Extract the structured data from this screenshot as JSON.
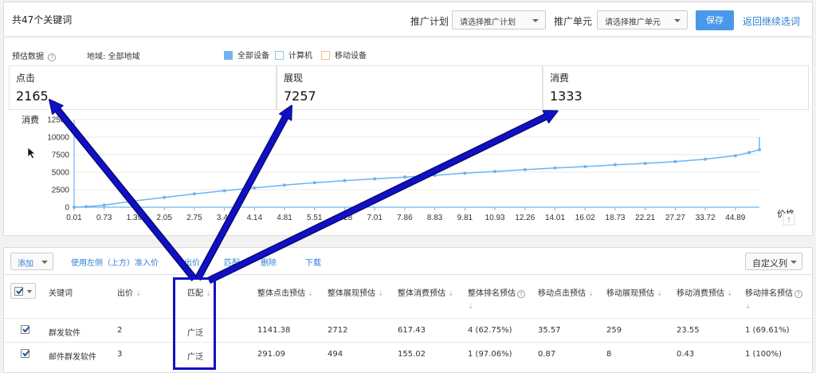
{
  "header": {
    "title": "共47个关键词",
    "plan_label": "推广计划",
    "plan_select": "请选择推广计划",
    "unit_label": "推广单元",
    "unit_select": "请选择推广单元",
    "save": "保存",
    "back": "返回继续选词"
  },
  "estimate": {
    "label": "预估数据",
    "region": "地域: 全部地域",
    "legend": [
      {
        "name": "全部设备",
        "color": "#6fb3f0",
        "filled": true
      },
      {
        "name": "计算机",
        "color": "#8fc5ea",
        "filled": false
      },
      {
        "name": "移动设备",
        "color": "#f0c080",
        "filled": false
      }
    ]
  },
  "stats": [
    {
      "name": "点击",
      "value": "2165"
    },
    {
      "name": "展现",
      "value": "7257"
    },
    {
      "name": "消费",
      "value": "1333"
    }
  ],
  "chart_data": {
    "type": "line",
    "ylabel": "消费",
    "xlabel": "价格",
    "ylim": [
      0,
      12500
    ],
    "yticks": [
      "0",
      "2500",
      "5000",
      "7500",
      "10000",
      "12500"
    ],
    "x": [
      "0.01",
      "0.73",
      "1.39",
      "2.05",
      "2.75",
      "3.44",
      "4.14",
      "4.81",
      "5.51",
      "6.28",
      "7.01",
      "7.86",
      "8.83",
      "9.81",
      "10.93",
      "12.26",
      "14.01",
      "16.02",
      "18.73",
      "22.21",
      "27.27",
      "33.72",
      "44.89"
    ],
    "series": [
      {
        "color": "#6fb3f0",
        "points_x": [
          0.01,
          0.3,
          0.73,
          1.39,
          2.05,
          2.75,
          3.44,
          4.14,
          4.81,
          5.51,
          6.28,
          7.01,
          7.86,
          8.83,
          9.81,
          10.93,
          12.26,
          14.01,
          16.02,
          18.73,
          22.21,
          27.27,
          33.72,
          44.89,
          50,
          55,
          56
        ],
        "points_y": [
          0,
          80,
          300,
          900,
          1400,
          1900,
          2350,
          2750,
          3150,
          3500,
          3800,
          4050,
          4300,
          4550,
          4850,
          5100,
          5350,
          5600,
          5800,
          6050,
          6250,
          6500,
          6850,
          7350,
          7800,
          8200,
          10000
        ]
      }
    ]
  },
  "toolbar": {
    "add": "添加",
    "use_left": "使用左侧（上方）准入价",
    "bid": "出价",
    "match": "匹配",
    "delete": "删除",
    "download": "下载",
    "custom_cols": "自定义列"
  },
  "table": {
    "columns": [
      "关键词",
      "出价",
      "匹配",
      "整体点击预估",
      "整体展现预估",
      "整体消费预估",
      "整体排名预估",
      "移动点击预估",
      "移动展现预估",
      "移动消费预估",
      "移动排名预估"
    ],
    "rows": [
      [
        "群发软件",
        "2",
        "广泛",
        "1141.38",
        "2712",
        "617.43",
        "4 (62.75%)",
        "35.57",
        "259",
        "23.55",
        "1 (69.61%)"
      ],
      [
        "邮件群发软件",
        "3",
        "广泛",
        "291.09",
        "494",
        "155.02",
        "1 (97.06%)",
        "0.87",
        "8",
        "0.43",
        "1 (100%)"
      ]
    ]
  },
  "colors": {
    "accent": "#4a98ea",
    "link": "#2f7fd4",
    "annotation": "#1010c8"
  }
}
